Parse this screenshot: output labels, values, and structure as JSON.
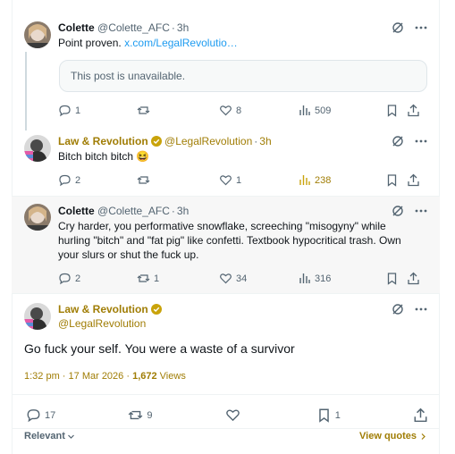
{
  "tweets": [
    {
      "name": "Colette",
      "handle": "@Colette_AFC",
      "time": "3h",
      "text": "Point proven.",
      "link": "x.com/LegalRevolutio…",
      "quote": "This post is unavailable.",
      "replies": "1",
      "reposts": "",
      "likes": "8",
      "views": "509"
    },
    {
      "name": "Law & Revolution",
      "handle": "@LegalRevolution",
      "time": "3h",
      "text": "Bitch bitch bitch 😆",
      "replies": "2",
      "reposts": "",
      "likes": "1",
      "views": "238"
    },
    {
      "name": "Colette",
      "handle": "@Colette_AFC",
      "time": "3h",
      "text": "Cry harder, you performative snowflake, screeching \"misogyny\" while hurling \"bitch\" and \"fat pig\" like confetti. Textbook hypocritical trash. Own your slurs or shut the fuck up.",
      "replies": "2",
      "reposts": "1",
      "likes": "34",
      "views": "316"
    }
  ],
  "main": {
    "name": "Law & Revolution",
    "handle": "@LegalRevolution",
    "text": "Go fuck your self. You were a waste of a survivor",
    "timestamp": "1:32 pm · 17 Mar 2026 ·",
    "views_count": "1,672",
    "views_label": "Views",
    "replies": "17",
    "reposts": "9",
    "likes": "",
    "bookmarks": "1"
  },
  "footer": {
    "sort_label": "Relevant",
    "view_quotes": "View quotes"
  },
  "colors": {
    "gold": "#a07d05",
    "link": "#1d9bf0",
    "muted": "#536471"
  }
}
